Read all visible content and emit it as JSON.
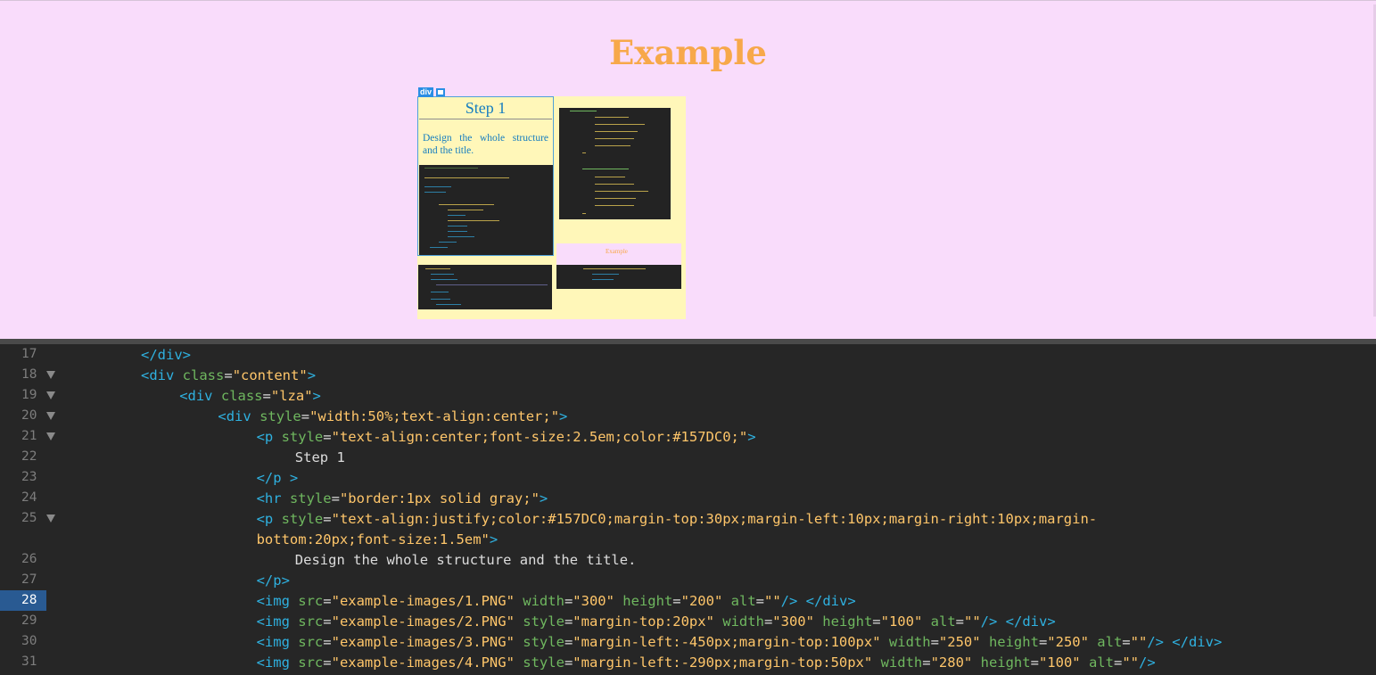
{
  "preview": {
    "title": "Example",
    "element_tag": "div",
    "step_title": "Step 1",
    "step_desc": "Design the whole structure and the title.",
    "mini_thumb_title": "Example"
  },
  "editor": {
    "active_line": "28",
    "lines": [
      {
        "num": "17",
        "fold": false,
        "indent": 4,
        "parts": [
          [
            "tg",
            "</div>"
          ]
        ]
      },
      {
        "num": "18",
        "fold": true,
        "indent": 4,
        "parts": [
          [
            "tg",
            "<div "
          ],
          [
            "at",
            "class"
          ],
          [
            "tx",
            "="
          ],
          [
            "st",
            "\"content\""
          ],
          [
            "tg",
            ">"
          ]
        ]
      },
      {
        "num": "19",
        "fold": true,
        "indent": 5,
        "parts": [
          [
            "tg",
            "<div "
          ],
          [
            "at",
            "class"
          ],
          [
            "tx",
            "="
          ],
          [
            "st",
            "\"lza\""
          ],
          [
            "tg",
            ">"
          ]
        ]
      },
      {
        "num": "20",
        "fold": true,
        "indent": 6,
        "parts": [
          [
            "tg",
            "<div "
          ],
          [
            "at",
            "style"
          ],
          [
            "tx",
            "="
          ],
          [
            "st",
            "\"width:50%;text-align:center;\""
          ],
          [
            "tg",
            ">"
          ]
        ]
      },
      {
        "num": "21",
        "fold": true,
        "indent": 7,
        "parts": [
          [
            "tg",
            "<p "
          ],
          [
            "at",
            "style"
          ],
          [
            "tx",
            "="
          ],
          [
            "st",
            "\"text-align:center;font-size:2.5em;color:#157DC0;\""
          ],
          [
            "tg",
            ">"
          ]
        ]
      },
      {
        "num": "22",
        "fold": false,
        "indent": 8,
        "parts": [
          [
            "tx",
            "Step 1"
          ]
        ]
      },
      {
        "num": "23",
        "fold": false,
        "indent": 7,
        "parts": [
          [
            "tg",
            "</p >"
          ]
        ]
      },
      {
        "num": "24",
        "fold": false,
        "indent": 7,
        "parts": [
          [
            "tg",
            "<hr "
          ],
          [
            "at",
            "style"
          ],
          [
            "tx",
            "="
          ],
          [
            "st",
            "\"border:1px solid gray;\""
          ],
          [
            "tg",
            ">"
          ]
        ]
      },
      {
        "num": "25",
        "fold": true,
        "indent": 7,
        "parts": [
          [
            "tg",
            "<p "
          ],
          [
            "at",
            "style"
          ],
          [
            "tx",
            "="
          ],
          [
            "st",
            "\"text-align:justify;color:#157DC0;margin-top:30px;margin-left:10px;margin-right:10px;margin-"
          ]
        ]
      },
      {
        "num": "",
        "fold": false,
        "indent": 7,
        "parts": [
          [
            "st",
            "bottom:20px;font-size:1.5em\""
          ],
          [
            "tg",
            ">"
          ]
        ]
      },
      {
        "num": "26",
        "fold": false,
        "indent": 8,
        "parts": [
          [
            "tx",
            "Design the whole structure and the title."
          ]
        ]
      },
      {
        "num": "27",
        "fold": false,
        "indent": 7,
        "parts": [
          [
            "tg",
            "</p>"
          ]
        ]
      },
      {
        "num": "28",
        "fold": false,
        "indent": 7,
        "parts": [
          [
            "tg",
            "<img "
          ],
          [
            "at",
            "src"
          ],
          [
            "tx",
            "="
          ],
          [
            "st",
            "\"example-images/1.PNG\""
          ],
          [
            "tx",
            " "
          ],
          [
            "at",
            "width"
          ],
          [
            "tx",
            "="
          ],
          [
            "st",
            "\"300\""
          ],
          [
            "tx",
            " "
          ],
          [
            "at",
            "height"
          ],
          [
            "tx",
            "="
          ],
          [
            "st",
            "\"200\""
          ],
          [
            "tx",
            " "
          ],
          [
            "at",
            "alt"
          ],
          [
            "tx",
            "="
          ],
          [
            "st",
            "\"\""
          ],
          [
            "tg",
            "/> </div>"
          ]
        ]
      },
      {
        "num": "29",
        "fold": false,
        "indent": 7,
        "parts": [
          [
            "tg",
            "<img "
          ],
          [
            "at",
            "src"
          ],
          [
            "tx",
            "="
          ],
          [
            "st",
            "\"example-images/2.PNG\""
          ],
          [
            "tx",
            " "
          ],
          [
            "at",
            "style"
          ],
          [
            "tx",
            "="
          ],
          [
            "st",
            "\"margin-top:20px\""
          ],
          [
            "tx",
            " "
          ],
          [
            "at",
            "width"
          ],
          [
            "tx",
            "="
          ],
          [
            "st",
            "\"300\""
          ],
          [
            "tx",
            " "
          ],
          [
            "at",
            "height"
          ],
          [
            "tx",
            "="
          ],
          [
            "st",
            "\"100\""
          ],
          [
            "tx",
            " "
          ],
          [
            "at",
            "alt"
          ],
          [
            "tx",
            "="
          ],
          [
            "st",
            "\"\""
          ],
          [
            "tg",
            "/> </div>"
          ]
        ]
      },
      {
        "num": "30",
        "fold": false,
        "indent": 7,
        "parts": [
          [
            "tg",
            "<img "
          ],
          [
            "at",
            "src"
          ],
          [
            "tx",
            "="
          ],
          [
            "st",
            "\"example-images/3.PNG\""
          ],
          [
            "tx",
            " "
          ],
          [
            "at",
            "style"
          ],
          [
            "tx",
            "="
          ],
          [
            "st",
            "\"margin-left:-450px;margin-top:100px\""
          ],
          [
            "tx",
            " "
          ],
          [
            "at",
            "width"
          ],
          [
            "tx",
            "="
          ],
          [
            "st",
            "\"250\""
          ],
          [
            "tx",
            " "
          ],
          [
            "at",
            "height"
          ],
          [
            "tx",
            "="
          ],
          [
            "st",
            "\"250\""
          ],
          [
            "tx",
            " "
          ],
          [
            "at",
            "alt"
          ],
          [
            "tx",
            "="
          ],
          [
            "st",
            "\"\""
          ],
          [
            "tg",
            "/> </div>"
          ]
        ]
      },
      {
        "num": "31",
        "fold": false,
        "indent": 7,
        "parts": [
          [
            "tg",
            "<img "
          ],
          [
            "at",
            "src"
          ],
          [
            "tx",
            "="
          ],
          [
            "st",
            "\"example-images/4.PNG\""
          ],
          [
            "tx",
            " "
          ],
          [
            "at",
            "style"
          ],
          [
            "tx",
            "="
          ],
          [
            "st",
            "\"margin-left:-290px;margin-top:50px\""
          ],
          [
            "tx",
            " "
          ],
          [
            "at",
            "width"
          ],
          [
            "tx",
            "="
          ],
          [
            "st",
            "\"280\""
          ],
          [
            "tx",
            " "
          ],
          [
            "at",
            "height"
          ],
          [
            "tx",
            "="
          ],
          [
            "st",
            "\"100\""
          ],
          [
            "tx",
            " "
          ],
          [
            "at",
            "alt"
          ],
          [
            "tx",
            "="
          ],
          [
            "st",
            "\"\""
          ],
          [
            "tg",
            "/>"
          ]
        ]
      }
    ]
  }
}
